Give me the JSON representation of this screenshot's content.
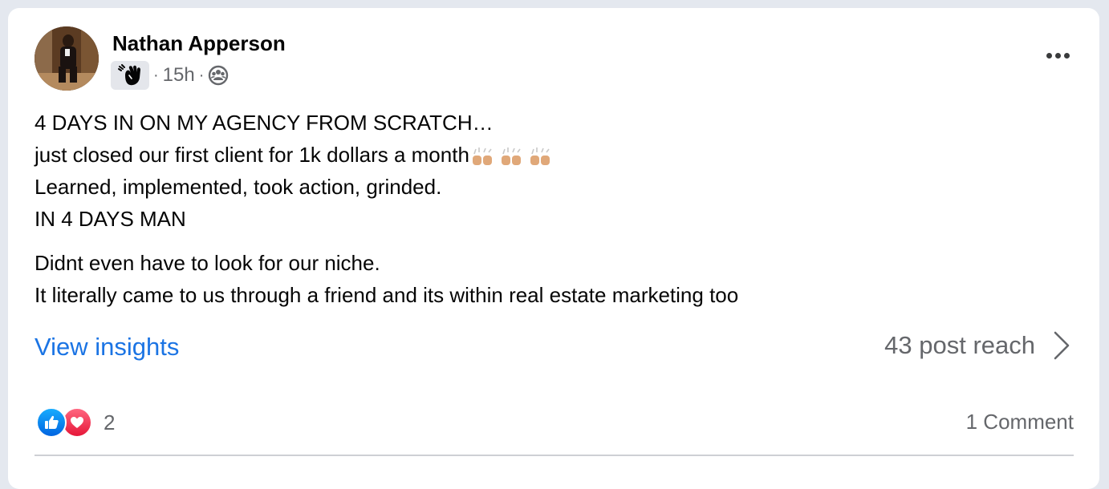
{
  "post": {
    "author": "Nathan Apperson",
    "badge_icon": "wave-hand-icon",
    "time": "15h",
    "separator": "·",
    "audience_icon": "group-audience-icon",
    "lines": [
      "4 DAYS IN ON MY AGENCY FROM SCRATCH…",
      "just closed our first client for 1k dollars a month",
      "Learned, implemented, took action, grinded.",
      "IN 4 DAYS MAN"
    ],
    "emoji": "raised-hands-emoji",
    "lines2": [
      "Didnt even have to look for our niche.",
      "It literally came to us through a friend and its within real estate marketing too"
    ]
  },
  "insights": {
    "label": "View insights",
    "reach": "43 post reach"
  },
  "footer": {
    "reaction_count": "2",
    "comments": "1 Comment"
  },
  "colors": {
    "link": "#1b74e4",
    "secondary_text": "#65676b",
    "like": "#0a7cff",
    "love": "#f33e58"
  }
}
